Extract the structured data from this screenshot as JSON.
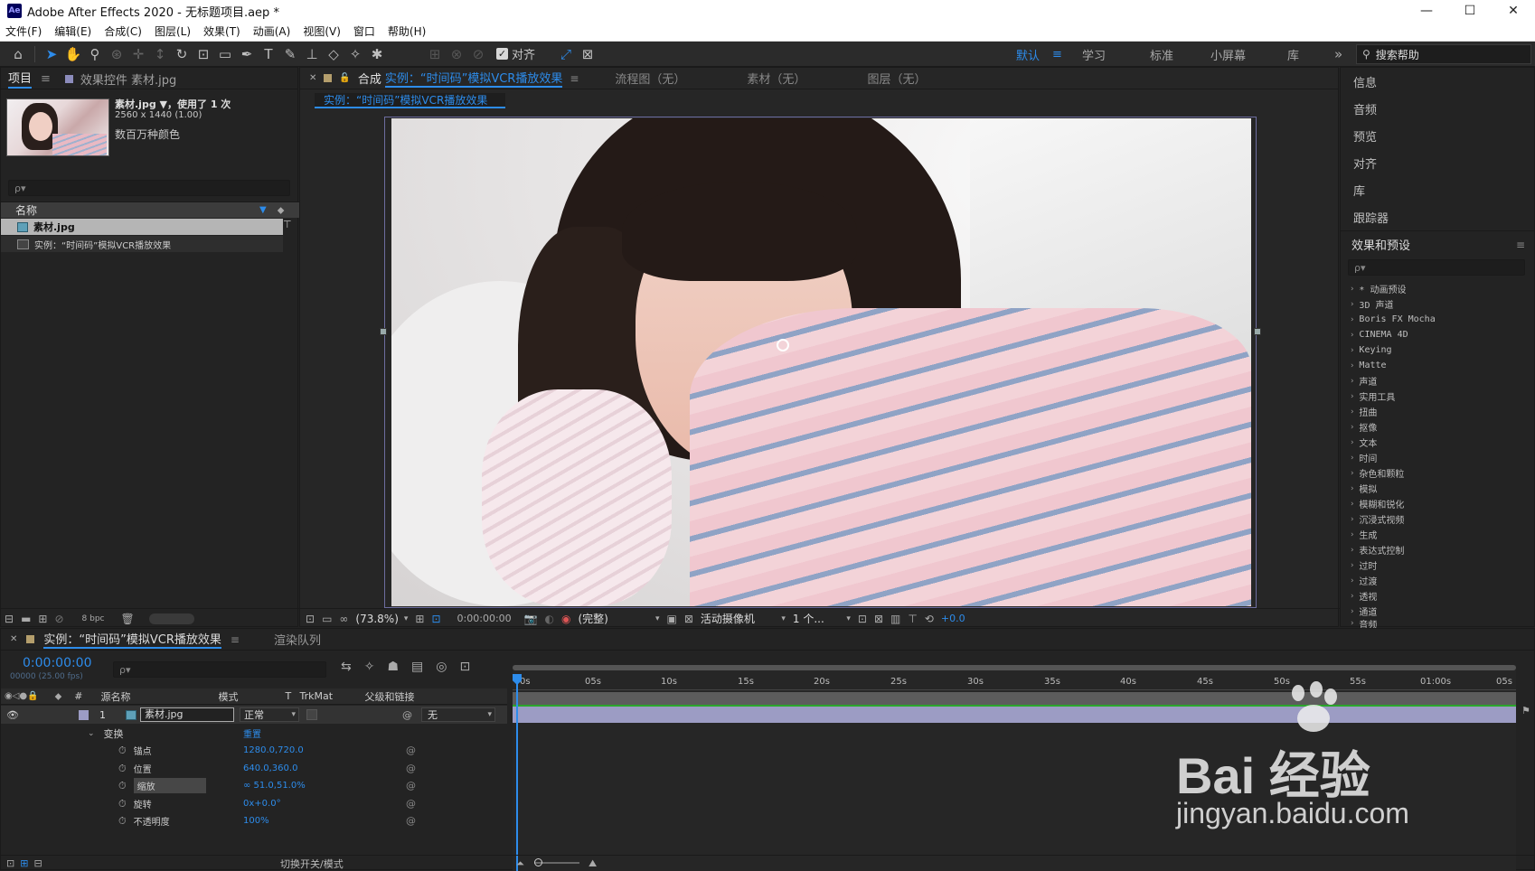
{
  "app": {
    "logo": "Ae",
    "title": "Adobe After Effects 2020 - 无标题项目.aep *"
  },
  "window_controls": {
    "minimize": "—",
    "maximize": "☐",
    "close": "✕"
  },
  "menu": [
    "文件(F)",
    "编辑(E)",
    "合成(C)",
    "图层(L)",
    "效果(T)",
    "动画(A)",
    "视图(V)",
    "窗口",
    "帮助(H)"
  ],
  "toolbar": {
    "snap_label": "对齐",
    "workspaces": [
      "默认",
      "学习",
      "标准",
      "小屏幕",
      "库"
    ],
    "active_workspace": "默认",
    "more": "»",
    "search_help": "搜索帮助"
  },
  "project_panel": {
    "tab_project": "项目",
    "tab_effects": "效果控件 素材.jpg",
    "asset_name": "素材.jpg ▼，使用了 1 次",
    "asset_dims": "2560 x 1440 (1.00)",
    "asset_colors": "数百万种颜色",
    "search_placeholder": "ρ▾",
    "col_name": "名称",
    "items": [
      {
        "name": "素材.jpg"
      },
      {
        "name": "实例：“时间码”模拟VCR播放效果"
      }
    ],
    "bpc": "8 bpc"
  },
  "comp_panel": {
    "tab_comp_prefix": "合成",
    "tab_comp_name": "实例：“时间码”模拟VCR播放效果",
    "tab_flow": "流程图（无）",
    "tab_footage": "素材（无）",
    "tab_layer": "图层（无）",
    "breadcrumb": "实例：“时间码”模拟VCR播放效果",
    "zoom": "(73.8%)",
    "timecode": "0:00:00:00",
    "resolution": "(完整)",
    "camera": "活动摄像机",
    "views": "1 个...",
    "exposure": "+0.0"
  },
  "right_panel": {
    "items": [
      "信息",
      "音频",
      "预览",
      "对齐",
      "库",
      "跟踪器"
    ],
    "effects_title": "效果和预设",
    "effects": [
      "* 动画预设",
      "3D 声道",
      "Boris FX Mocha",
      "CINEMA 4D",
      "Keying",
      "Matte",
      "声道",
      "实用工具",
      "扭曲",
      "抠像",
      "文本",
      "时间",
      "杂色和颗粒",
      "模拟",
      "模糊和锐化",
      "沉浸式视频",
      "生成",
      "表达式控制",
      "过时",
      "过渡",
      "透视",
      "通道",
      "音频"
    ]
  },
  "timeline": {
    "tab_comp": "实例：“时间码”模拟VCR播放效果",
    "tab_render": "渲染队列",
    "timecode": "0:00:00:00",
    "timecode_sub": "00000 (25.00 fps)",
    "headers": {
      "num": "#",
      "source": "源名称",
      "mode": "模式",
      "t": "T",
      "trkmat": "TrkMat",
      "parent": "父级和链接"
    },
    "layer": {
      "num": "1",
      "name": "素材.jpg",
      "mode": "正常",
      "parent": "无"
    },
    "transform_label": "变换",
    "reset": "重置",
    "props": [
      {
        "name": "锚点",
        "value": "1280.0,720.0"
      },
      {
        "name": "位置",
        "value": "640.0,360.0"
      },
      {
        "name": "缩放",
        "value": "∞ 51.0,51.0%"
      },
      {
        "name": "旋转",
        "value": "0x+0.0°"
      },
      {
        "name": "不透明度",
        "value": "100%"
      }
    ],
    "ruler": [
      "0s",
      "05s",
      "10s",
      "15s",
      "20s",
      "25s",
      "30s",
      "35s",
      "40s",
      "45s",
      "50s",
      "55s",
      "01:00s",
      "05s"
    ],
    "footer_toggle": "切换开关/模式"
  },
  "watermark": {
    "brand": "Bai 经验",
    "url": "jingyan.baidu.com"
  },
  "colors": {
    "accent": "#2d8ceb",
    "panel": "#232323",
    "header": "#2b2b2b",
    "layer_bar": "#9c9cc4"
  }
}
